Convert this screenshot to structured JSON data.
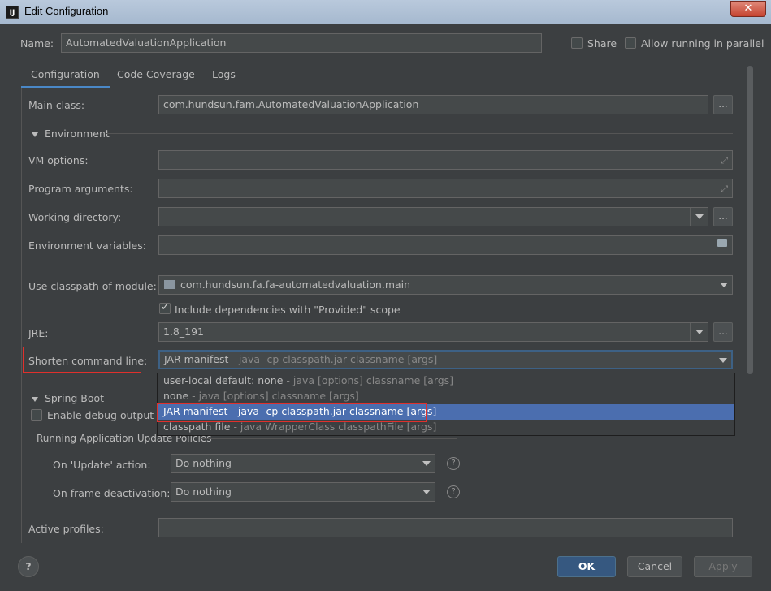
{
  "window": {
    "title": "Edit Configuration",
    "close_glyph": "✕"
  },
  "name_field": {
    "label": "Name:",
    "value": "AutomatedValuationApplication"
  },
  "share": {
    "label": "Share",
    "checked": false
  },
  "parallel": {
    "label": "Allow running in parallel",
    "checked": false
  },
  "tabs": [
    {
      "label": "Configuration",
      "active": true
    },
    {
      "label": "Code Coverage",
      "active": false
    },
    {
      "label": "Logs",
      "active": false
    }
  ],
  "main_class": {
    "label": "Main class:",
    "value": "com.hundsun.fam.AutomatedValuationApplication",
    "browse": "..."
  },
  "environment": {
    "header": "Environment",
    "vm_options": {
      "label": "VM options:",
      "value": ""
    },
    "program_args": {
      "label": "Program arguments:",
      "value": ""
    },
    "working_dir": {
      "label": "Working directory:",
      "value": "",
      "browse": "..."
    },
    "env_vars": {
      "label": "Environment variables:",
      "value": ""
    }
  },
  "classpath": {
    "label": "Use classpath of module:",
    "value": "com.hundsun.fa.fa-automatedvaluation.main"
  },
  "include_provided": {
    "label": "Include dependencies with \"Provided\" scope",
    "checked": true
  },
  "jre": {
    "label": "JRE:",
    "value": "1.8_191",
    "browse": "..."
  },
  "shorten": {
    "label": "Shorten command line:",
    "selected_main": "JAR manifest",
    "selected_hint": " - java -cp classpath.jar classname [args]",
    "options": [
      {
        "main": "user-local default: none",
        "hint": " - java [options] classname [args]",
        "selected": false
      },
      {
        "main": "none",
        "hint": " - java [options] classname [args]",
        "selected": false
      },
      {
        "main": "JAR manifest",
        "hint": " - java -cp classpath.jar classname [args]",
        "selected": true
      },
      {
        "main": "classpath file",
        "hint": " - java WrapperClass classpathFile [args]",
        "selected": false
      }
    ]
  },
  "spring_boot": {
    "header": "Spring Boot",
    "debug_output": {
      "label": "Enable debug output",
      "checked": false
    },
    "update_policies": "Running Application Update Policies",
    "on_update": {
      "label": "On 'Update' action:",
      "value": "Do nothing"
    },
    "on_frame": {
      "label": "On frame deactivation:",
      "value": "Do nothing"
    },
    "help_glyph": "?"
  },
  "active_profiles": {
    "label": "Active profiles:",
    "value": ""
  },
  "footer": {
    "help": "?",
    "ok": "OK",
    "cancel": "Cancel",
    "apply": "Apply"
  },
  "colors": {
    "accent": "#4b6eaf",
    "highlight_box": "#e0302c",
    "primary_button": "#365880"
  }
}
